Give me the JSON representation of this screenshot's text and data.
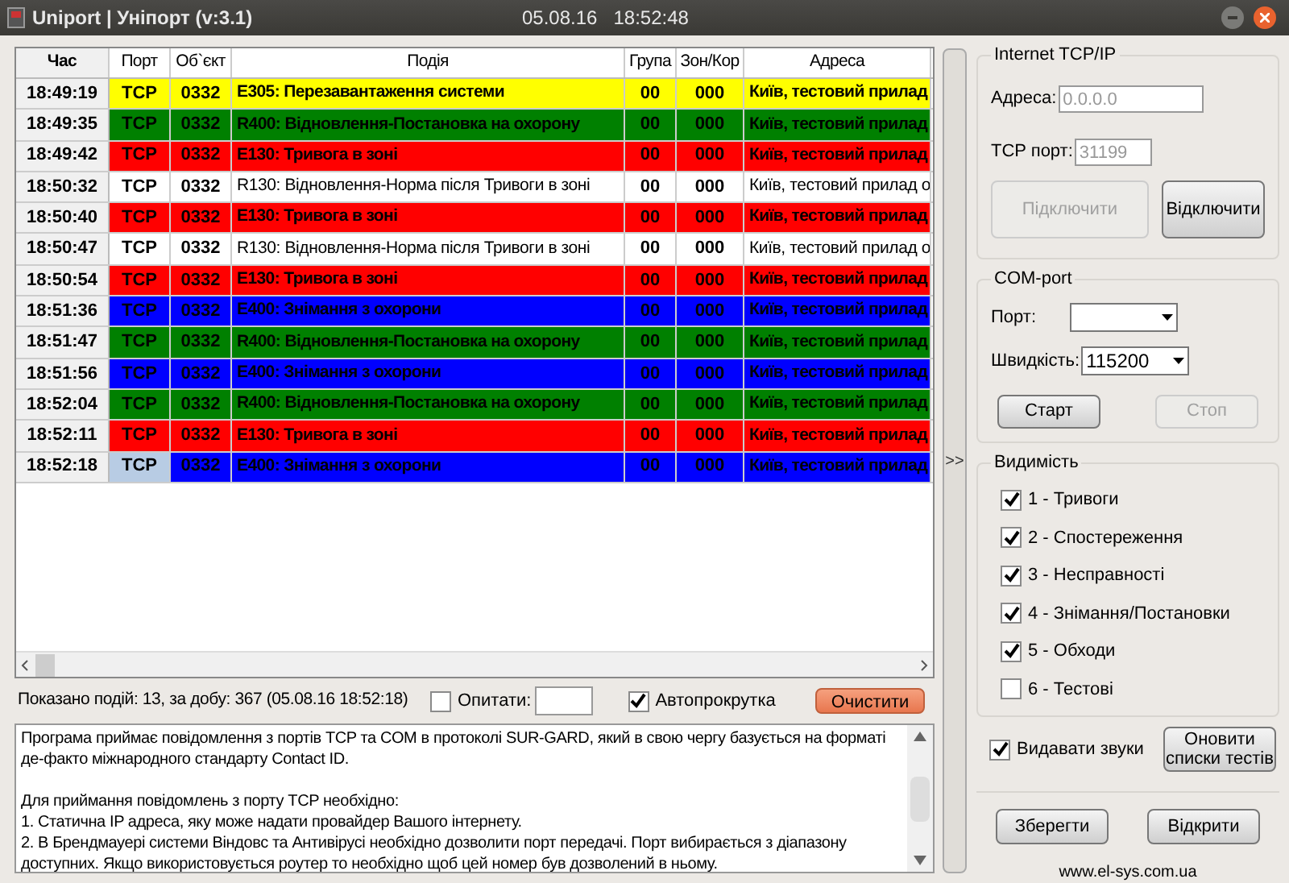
{
  "window": {
    "title": "Uniport | Уніпорт (v:3.1)",
    "date": "05.08.16",
    "time": "18:52:48"
  },
  "table": {
    "columns": [
      "Час",
      "Порт",
      "Об`єкт",
      "Подія",
      "Група",
      "Зон/Кор",
      "Адреса"
    ],
    "rows": [
      {
        "time": "18:49:19",
        "port": "TCP",
        "object": "0332",
        "event": "E305: Перезавантаження системи",
        "group": "00",
        "zone": "000",
        "address": "Київ, тестовий прилад",
        "color": "#ffff00",
        "highlighted": true,
        "selected": false
      },
      {
        "time": "18:49:35",
        "port": "TCP",
        "object": "0332",
        "event": "R400: Відновлення-Постановка на охорону",
        "group": "00",
        "zone": "000",
        "address": "Київ, тестовий прилад",
        "color": "#008000",
        "highlighted": true,
        "selected": false
      },
      {
        "time": "18:49:42",
        "port": "TCP",
        "object": "0332",
        "event": "E130: Тривога в зоні",
        "group": "00",
        "zone": "000",
        "address": "Київ, тестовий прилад",
        "color": "#ff0000",
        "highlighted": true,
        "selected": false
      },
      {
        "time": "18:50:32",
        "port": "TCP",
        "object": "0332",
        "event": "R130: Відновлення-Норма після Тривоги в зоні",
        "group": "00",
        "zone": "000",
        "address": "Київ, тестовий прилад о",
        "color": "#ffffff",
        "highlighted": false,
        "selected": false
      },
      {
        "time": "18:50:40",
        "port": "TCP",
        "object": "0332",
        "event": "E130: Тривога в зоні",
        "group": "00",
        "zone": "000",
        "address": "Київ, тестовий прилад",
        "color": "#ff0000",
        "highlighted": true,
        "selected": false
      },
      {
        "time": "18:50:47",
        "port": "TCP",
        "object": "0332",
        "event": "R130: Відновлення-Норма після Тривоги в зоні",
        "group": "00",
        "zone": "000",
        "address": "Київ, тестовий прилад о",
        "color": "#ffffff",
        "highlighted": false,
        "selected": false
      },
      {
        "time": "18:50:54",
        "port": "TCP",
        "object": "0332",
        "event": "E130: Тривога в зоні",
        "group": "00",
        "zone": "000",
        "address": "Київ, тестовий прилад",
        "color": "#ff0000",
        "highlighted": true,
        "selected": false
      },
      {
        "time": "18:51:36",
        "port": "TCP",
        "object": "0332",
        "event": "E400: Знімання з охорони",
        "group": "00",
        "zone": "000",
        "address": "Київ, тестовий прилад",
        "color": "#0000ff",
        "highlighted": true,
        "selected": false
      },
      {
        "time": "18:51:47",
        "port": "TCP",
        "object": "0332",
        "event": "R400: Відновлення-Постановка на охорону",
        "group": "00",
        "zone": "000",
        "address": "Київ, тестовий прилад",
        "color": "#008000",
        "highlighted": true,
        "selected": false
      },
      {
        "time": "18:51:56",
        "port": "TCP",
        "object": "0332",
        "event": "E400: Знімання з охорони",
        "group": "00",
        "zone": "000",
        "address": "Київ, тестовий прилад",
        "color": "#0000ff",
        "highlighted": true,
        "selected": false
      },
      {
        "time": "18:52:04",
        "port": "TCP",
        "object": "0332",
        "event": "R400: Відновлення-Постановка на охорону",
        "group": "00",
        "zone": "000",
        "address": "Київ, тестовий прилад",
        "color": "#008000",
        "highlighted": true,
        "selected": false
      },
      {
        "time": "18:52:11",
        "port": "TCP",
        "object": "0332",
        "event": "E130: Тривога в зоні",
        "group": "00",
        "zone": "000",
        "address": "Київ, тестовий прилад",
        "color": "#ff0000",
        "highlighted": true,
        "selected": false
      },
      {
        "time": "18:52:18",
        "port": "TCP",
        "object": "0332",
        "event": "E400: Знімання з охорони",
        "group": "00",
        "zone": "000",
        "address": "Київ, тестовий прилад",
        "color": "#0000ff",
        "highlighted": true,
        "selected": true
      }
    ]
  },
  "status": {
    "summary": "Показано подій: 13, за добу: 367 (05.08.16 18:52:18)",
    "poll": {
      "label": "Опитати:",
      "checked": false
    },
    "autoscroll": {
      "label": "Автопрокрутка",
      "checked": true
    },
    "clear_button": "Очистити"
  },
  "log": [
    [
      "Програма приймає повідомлення з портів TCP та COM в протоколі SUR-GARD, який в свою чергу базується на форматі де-факто міжнародного стандарту Contact ID."
    ],
    [
      "Для приймання повідомлень з порту TCP необхідно:",
      "1. Статична IP адреса, яку може надати провайдер Вашого інтернету.",
      "2. В Брендмауері системи Віндовс та Антивірусі необхідно дозволити порт передачі. Порт вибирається з діапазону доступних. Якщо використовується роутер то необхідно щоб цей номер був дозволений в ньому."
    ]
  ],
  "collapse_button": ">>",
  "tcp": {
    "title": "Internet TCP/IP",
    "address_label": "Адреса:",
    "address_placeholder": "0.0.0.0",
    "port_label": "TCP порт:",
    "port_placeholder": "31199",
    "connect": {
      "label": "Підключити",
      "disabled": true
    },
    "disconnect": {
      "label": "Відключити",
      "disabled": false
    }
  },
  "com": {
    "title": "COM-port",
    "port_label": "Порт:",
    "speed_label": "Швидкість:",
    "speed": "115200",
    "start": {
      "label": "Старт",
      "disabled": false
    },
    "stop": {
      "label": "Стоп",
      "disabled": true
    }
  },
  "visibility": {
    "title": "Видимість",
    "items": [
      {
        "label": "1 - Тривоги",
        "checked": true
      },
      {
        "label": "2 - Спостереження",
        "checked": true
      },
      {
        "label": "3 - Несправності",
        "checked": true
      },
      {
        "label": "4 - Знімання/Постановки",
        "checked": true
      },
      {
        "label": "5 - Обходи",
        "checked": true
      },
      {
        "label": "6 - Тестові",
        "checked": false
      }
    ]
  },
  "sounds": {
    "label": "Видавати звуки",
    "checked": true
  },
  "update_button": "Оновити списки тестів",
  "save_button": "Зберегти",
  "open_button": "Відкрити",
  "website": "www.el-sys.com.ua"
}
